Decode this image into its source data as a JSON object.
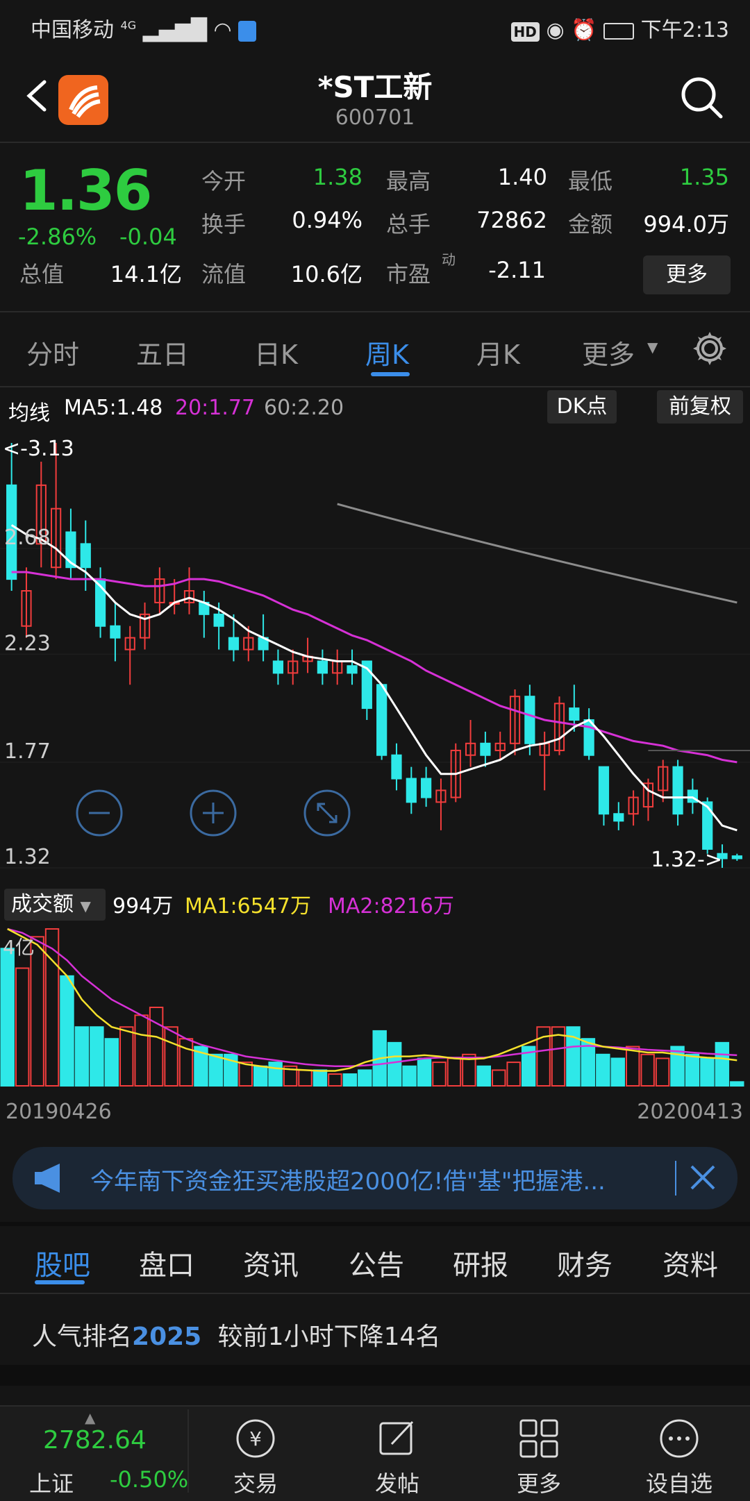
{
  "status_bar": {
    "carrier": "中国移动",
    "network": "4G",
    "time": "下午2:13",
    "hd": "HD"
  },
  "header": {
    "title": "*ST工新",
    "code": "600701"
  },
  "quote": {
    "price": "1.36",
    "change_pct": "-2.86%",
    "change": "-0.04",
    "fields": [
      {
        "label": "今开",
        "value": "1.38",
        "color": "#2ecc40"
      },
      {
        "label": "最高",
        "value": "1.40",
        "color": "#ffffff"
      },
      {
        "label": "最低",
        "value": "1.35",
        "color": "#2ecc40"
      },
      {
        "label": "换手",
        "value": "0.94%",
        "color": "#ffffff"
      },
      {
        "label": "总手",
        "value": "72862",
        "color": "#ffffff"
      },
      {
        "label": "金额",
        "value": "994.0万",
        "color": "#ffffff"
      },
      {
        "label": "总值",
        "value": "14.1亿",
        "color": "#ffffff"
      },
      {
        "label": "流值",
        "value": "10.6亿",
        "color": "#ffffff"
      },
      {
        "label": "市盈",
        "value": "-2.11",
        "color": "#ffffff",
        "sup": "动"
      }
    ],
    "more_label": "更多"
  },
  "tabs": [
    "分时",
    "五日",
    "日K",
    "周K",
    "月K",
    "更多"
  ],
  "active_tab": "周K",
  "ma": {
    "label": "均线",
    "ma5": "MA5:1.48",
    "ma20": "20:1.77",
    "ma60": "60:2.20",
    "dk_label": "DK点",
    "fq_label": "前复权"
  },
  "price_axis": [
    "2.68",
    "2.23",
    "1.77",
    "1.32"
  ],
  "high_marker": "<-3.13",
  "low_marker": "1.32->",
  "volume": {
    "selector_label": "成交额",
    "current": "994万",
    "ma1": "MA1:6547万",
    "ma2": "MA2:8216万",
    "axis_top": "4亿"
  },
  "dates": {
    "start": "20190426",
    "end": "20200413"
  },
  "colors": {
    "up": "#f23d3d",
    "down": "#2ee8e8",
    "ma5": "#ffffff",
    "ma20": "#d631d6",
    "ma60": "#8c8c8c",
    "accent": "#3b8eea"
  },
  "news": {
    "text": "今年南下资金狂买港股超2000亿!借\"基\"把握港..."
  },
  "section_tabs": [
    "股吧",
    "盘口",
    "资讯",
    "公告",
    "研报",
    "财务",
    "资料"
  ],
  "active_section": "股吧",
  "rank": {
    "prefix": "人气排名",
    "number": "2025",
    "suffix": "较前1小时下降14名"
  },
  "bottom_nav": {
    "index_value": "2782.64",
    "index_name": "上证",
    "index_change": "-0.50%",
    "items": [
      "交易",
      "发帖",
      "更多",
      "设自选"
    ]
  },
  "chart_data": {
    "type": "candlestick",
    "title": "",
    "ylim": [
      1.32,
      3.13
    ],
    "x": [
      "20190426",
      "20200413"
    ],
    "candles": [
      {
        "o": 2.95,
        "c": 2.55,
        "h": 3.13,
        "l": 2.5
      },
      {
        "o": 2.35,
        "c": 2.5,
        "h": 2.6,
        "l": 2.3
      },
      {
        "o": 2.7,
        "c": 2.95,
        "h": 3.05,
        "l": 2.6
      },
      {
        "o": 2.6,
        "c": 2.85,
        "h": 3.13,
        "l": 2.55
      },
      {
        "o": 2.75,
        "c": 2.6,
        "h": 2.85,
        "l": 2.55
      },
      {
        "o": 2.7,
        "c": 2.6,
        "h": 2.8,
        "l": 2.5
      },
      {
        "o": 2.55,
        "c": 2.35,
        "h": 2.6,
        "l": 2.3
      },
      {
        "o": 2.35,
        "c": 2.3,
        "h": 2.45,
        "l": 2.2
      },
      {
        "o": 2.25,
        "c": 2.3,
        "h": 2.35,
        "l": 2.1
      },
      {
        "o": 2.3,
        "c": 2.4,
        "h": 2.45,
        "l": 2.25
      },
      {
        "o": 2.45,
        "c": 2.55,
        "h": 2.6,
        "l": 2.4
      },
      {
        "o": 2.45,
        "c": 2.45,
        "h": 2.55,
        "l": 2.4
      },
      {
        "o": 2.45,
        "c": 2.5,
        "h": 2.6,
        "l": 2.4
      },
      {
        "o": 2.45,
        "c": 2.4,
        "h": 2.5,
        "l": 2.3
      },
      {
        "o": 2.4,
        "c": 2.35,
        "h": 2.45,
        "l": 2.25
      },
      {
        "o": 2.3,
        "c": 2.25,
        "h": 2.4,
        "l": 2.2
      },
      {
        "o": 2.25,
        "c": 2.3,
        "h": 2.35,
        "l": 2.2
      },
      {
        "o": 2.3,
        "c": 2.25,
        "h": 2.4,
        "l": 2.2
      },
      {
        "o": 2.2,
        "c": 2.15,
        "h": 2.25,
        "l": 2.1
      },
      {
        "o": 2.15,
        "c": 2.2,
        "h": 2.25,
        "l": 2.1
      },
      {
        "o": 2.2,
        "c": 2.22,
        "h": 2.3,
        "l": 2.15
      },
      {
        "o": 2.2,
        "c": 2.15,
        "h": 2.25,
        "l": 2.1
      },
      {
        "o": 2.15,
        "c": 2.2,
        "h": 2.25,
        "l": 2.1
      },
      {
        "o": 2.18,
        "c": 2.15,
        "h": 2.25,
        "l": 2.1
      },
      {
        "o": 2.2,
        "c": 2.0,
        "h": 2.2,
        "l": 1.95
      },
      {
        "o": 2.1,
        "c": 1.8,
        "h": 2.1,
        "l": 1.78
      },
      {
        "o": 1.8,
        "c": 1.7,
        "h": 1.85,
        "l": 1.65
      },
      {
        "o": 1.7,
        "c": 1.6,
        "h": 1.75,
        "l": 1.55
      },
      {
        "o": 1.7,
        "c": 1.62,
        "h": 1.75,
        "l": 1.58
      },
      {
        "o": 1.6,
        "c": 1.65,
        "h": 1.7,
        "l": 1.48
      },
      {
        "o": 1.62,
        "c": 1.82,
        "h": 1.85,
        "l": 1.6
      },
      {
        "o": 1.8,
        "c": 1.85,
        "h": 1.95,
        "l": 1.75
      },
      {
        "o": 1.85,
        "c": 1.8,
        "h": 1.9,
        "l": 1.75
      },
      {
        "o": 1.82,
        "c": 1.85,
        "h": 1.9,
        "l": 1.78
      },
      {
        "o": 1.85,
        "c": 2.05,
        "h": 2.08,
        "l": 1.8
      },
      {
        "o": 2.05,
        "c": 1.85,
        "h": 2.1,
        "l": 1.8
      },
      {
        "o": 1.8,
        "c": 1.85,
        "h": 1.9,
        "l": 1.65
      },
      {
        "o": 1.82,
        "c": 2.02,
        "h": 2.05,
        "l": 1.8
      },
      {
        "o": 2.0,
        "c": 1.95,
        "h": 2.1,
        "l": 1.9
      },
      {
        "o": 1.95,
        "c": 1.8,
        "h": 2.0,
        "l": 1.78
      },
      {
        "o": 1.75,
        "c": 1.55,
        "h": 1.75,
        "l": 1.5
      },
      {
        "o": 1.55,
        "c": 1.52,
        "h": 1.6,
        "l": 1.48
      },
      {
        "o": 1.55,
        "c": 1.62,
        "h": 1.65,
        "l": 1.5
      },
      {
        "o": 1.58,
        "c": 1.68,
        "h": 1.7,
        "l": 1.52
      },
      {
        "o": 1.65,
        "c": 1.75,
        "h": 1.78,
        "l": 1.6
      },
      {
        "o": 1.75,
        "c": 1.55,
        "h": 1.78,
        "l": 1.5
      },
      {
        "o": 1.65,
        "c": 1.6,
        "h": 1.7,
        "l": 1.55
      },
      {
        "o": 1.6,
        "c": 1.4,
        "h": 1.62,
        "l": 1.38
      },
      {
        "o": 1.38,
        "c": 1.36,
        "h": 1.42,
        "l": 1.32
      },
      {
        "o": 1.37,
        "c": 1.36,
        "h": 1.38,
        "l": 1.35
      }
    ],
    "ma5": [
      2.78,
      2.74,
      2.72,
      2.68,
      2.62,
      2.58,
      2.52,
      2.45,
      2.4,
      2.38,
      2.4,
      2.45,
      2.47,
      2.45,
      2.42,
      2.38,
      2.33,
      2.3,
      2.27,
      2.24,
      2.22,
      2.21,
      2.2,
      2.2,
      2.17,
      2.1,
      2.0,
      1.9,
      1.8,
      1.72,
      1.72,
      1.74,
      1.76,
      1.78,
      1.82,
      1.84,
      1.85,
      1.87,
      1.92,
      1.95,
      1.88,
      1.8,
      1.72,
      1.65,
      1.62,
      1.62,
      1.62,
      1.58,
      1.5,
      1.48
    ],
    "ma20": [
      2.58,
      2.58,
      2.57,
      2.56,
      2.55,
      2.55,
      2.55,
      2.54,
      2.53,
      2.52,
      2.52,
      2.53,
      2.55,
      2.55,
      2.54,
      2.52,
      2.5,
      2.48,
      2.45,
      2.42,
      2.4,
      2.37,
      2.34,
      2.31,
      2.29,
      2.26,
      2.23,
      2.2,
      2.16,
      2.13,
      2.1,
      2.07,
      2.04,
      2.01,
      1.99,
      1.97,
      1.95,
      1.94,
      1.93,
      1.92,
      1.9,
      1.88,
      1.86,
      1.85,
      1.84,
      1.82,
      1.81,
      1.8,
      1.78,
      1.77
    ],
    "volume": [
      3.5,
      3.0,
      3.8,
      4.0,
      2.8,
      1.5,
      1.5,
      1.2,
      1.5,
      1.8,
      2.0,
      1.5,
      1.2,
      1.0,
      0.8,
      0.8,
      0.6,
      0.5,
      0.6,
      0.5,
      0.4,
      0.4,
      0.3,
      0.3,
      0.4,
      1.4,
      1.1,
      0.5,
      0.7,
      0.6,
      0.7,
      0.8,
      0.5,
      0.4,
      0.6,
      1.0,
      1.5,
      1.5,
      1.5,
      1.2,
      0.8,
      0.7,
      1.0,
      0.8,
      0.7,
      1.0,
      0.8,
      0.7,
      1.1,
      0.1
    ],
    "volume_ma1": [
      4.0,
      3.8,
      3.6,
      3.2,
      2.8,
      2.2,
      1.8,
      1.5,
      1.4,
      1.3,
      1.25,
      1.1,
      0.95,
      0.85,
      0.75,
      0.65,
      0.55,
      0.5,
      0.45,
      0.42,
      0.4,
      0.38,
      0.38,
      0.45,
      0.6,
      0.7,
      0.75,
      0.75,
      0.78,
      0.75,
      0.7,
      0.68,
      0.7,
      0.8,
      0.95,
      1.1,
      1.25,
      1.3,
      1.25,
      1.1,
      1.0,
      0.95,
      0.9,
      0.85,
      0.85,
      0.8,
      0.75,
      0.72,
      0.7,
      0.65
    ],
    "volume_ma2": [
      4.0,
      3.9,
      3.7,
      3.5,
      3.2,
      2.8,
      2.5,
      2.2,
      2.0,
      1.8,
      1.6,
      1.4,
      1.2,
      1.05,
      0.95,
      0.85,
      0.75,
      0.7,
      0.65,
      0.6,
      0.55,
      0.52,
      0.5,
      0.5,
      0.52,
      0.55,
      0.6,
      0.65,
      0.7,
      0.72,
      0.72,
      0.72,
      0.72,
      0.75,
      0.8,
      0.85,
      0.9,
      0.95,
      1.0,
      1.02,
      1.0,
      0.98,
      0.95,
      0.92,
      0.9,
      0.88,
      0.85,
      0.82,
      0.8,
      0.78
    ],
    "volume_ylim": [
      0,
      4.0
    ]
  }
}
